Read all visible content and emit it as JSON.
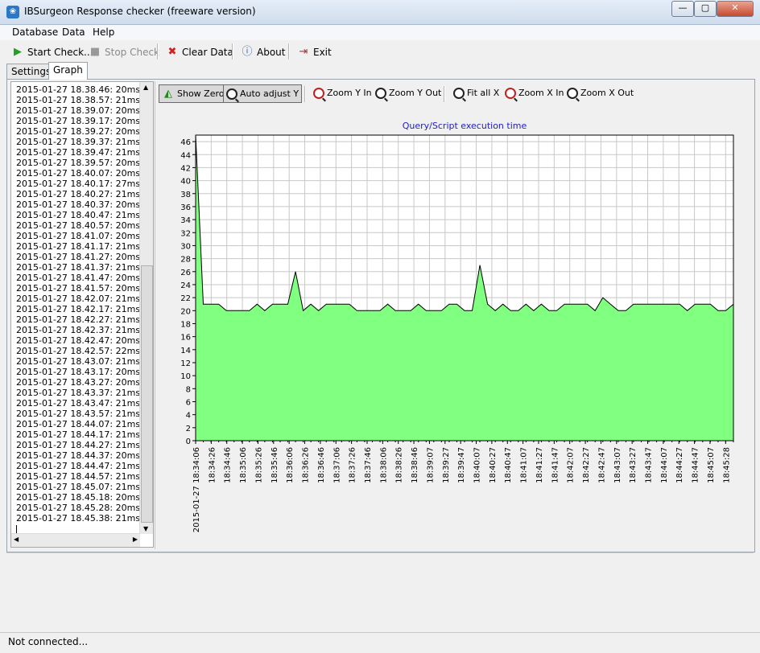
{
  "window": {
    "title": "IBSurgeon Response checker  (freeware version)",
    "buttons": {
      "minimize": "—",
      "maximize": "▢",
      "close": "✕"
    }
  },
  "menu": [
    "Database",
    "Data",
    "Help"
  ],
  "toolbar": {
    "start_check": "Start Check...",
    "stop_check": "Stop Check",
    "clear_data": "Clear Data",
    "about": "About",
    "exit": "Exit"
  },
  "tabs": [
    "Settings",
    "Graph"
  ],
  "log": [
    "2015-01-27 18.38.46: 20ms",
    "2015-01-27 18.38.57: 21ms",
    "2015-01-27 18.39.07: 20ms",
    "2015-01-27 18.39.17: 20ms",
    "2015-01-27 18.39.27: 20ms",
    "2015-01-27 18.39.37: 21ms",
    "2015-01-27 18.39.47: 21ms",
    "2015-01-27 18.39.57: 20ms",
    "2015-01-27 18.40.07: 20ms",
    "2015-01-27 18.40.17: 27ms",
    "2015-01-27 18.40.27: 21ms",
    "2015-01-27 18.40.37: 20ms",
    "2015-01-27 18.40.47: 21ms",
    "2015-01-27 18.40.57: 20ms",
    "2015-01-27 18.41.07: 20ms",
    "2015-01-27 18.41.17: 21ms",
    "2015-01-27 18.41.27: 20ms",
    "2015-01-27 18.41.37: 21ms",
    "2015-01-27 18.41.47: 20ms",
    "2015-01-27 18.41.57: 20ms",
    "2015-01-27 18.42.07: 21ms",
    "2015-01-27 18.42.17: 21ms",
    "2015-01-27 18.42.27: 21ms",
    "2015-01-27 18.42.37: 21ms",
    "2015-01-27 18.42.47: 20ms",
    "2015-01-27 18.42.57: 22ms",
    "2015-01-27 18.43.07: 21ms",
    "2015-01-27 18.43.17: 20ms",
    "2015-01-27 18.43.27: 20ms",
    "2015-01-27 18.43.37: 21ms",
    "2015-01-27 18.43.47: 21ms",
    "2015-01-27 18.43.57: 21ms",
    "2015-01-27 18.44.07: 21ms",
    "2015-01-27 18.44.17: 21ms",
    "2015-01-27 18.44.27: 21ms",
    "2015-01-27 18.44.37: 20ms",
    "2015-01-27 18.44.47: 21ms",
    "2015-01-27 18.44.57: 21ms",
    "2015-01-27 18.45.07: 21ms",
    "2015-01-27 18.45.18: 20ms",
    "2015-01-27 18.45.28: 20ms",
    "2015-01-27 18.45.38: 21ms"
  ],
  "graph_toolbar": {
    "show_zero": "Show Zero",
    "auto_adjust_y": "Auto adjust Y",
    "zoom_y_in": "Zoom Y In",
    "zoom_y_out": "Zoom Y Out",
    "fit_all_x": "Fit all X",
    "zoom_x_in": "Zoom X In",
    "zoom_x_out": "Zoom X Out"
  },
  "colors": {
    "fill": "#80ff80",
    "title": "#2020c0"
  },
  "chart_data": {
    "type": "area",
    "title": "Query/Script execution time",
    "ylim": [
      0,
      47
    ],
    "yticks": [
      0,
      2,
      4,
      6,
      8,
      10,
      12,
      14,
      16,
      18,
      20,
      22,
      24,
      26,
      28,
      30,
      32,
      34,
      36,
      38,
      40,
      42,
      44,
      46
    ],
    "grid": true,
    "x_tick_labels": [
      "2015-01-27 18:34:06",
      "18:34:26",
      "18:34:46",
      "18:35:06",
      "18:35:26",
      "18:35:46",
      "18:36:06",
      "18:36:26",
      "18:36:46",
      "18:37:06",
      "18:37:26",
      "18:37:46",
      "18:38:06",
      "18:38:26",
      "18:38:46",
      "18:39:07",
      "18:39:27",
      "18:39:47",
      "18:40:07",
      "18:40:27",
      "18:40:47",
      "18:41:07",
      "18:41:27",
      "18:41:47",
      "18:42:07",
      "18:42:27",
      "18:42:47",
      "18:43:07",
      "18:43:27",
      "18:43:47",
      "18:44:07",
      "18:44:27",
      "18:44:47",
      "18:45:07",
      "18:45:28"
    ],
    "values": [
      47,
      21,
      21,
      21,
      20,
      20,
      20,
      20,
      21,
      20,
      21,
      21,
      21,
      26,
      20,
      21,
      20,
      21,
      21,
      21,
      21,
      20,
      20,
      20,
      20,
      21,
      20,
      20,
      20,
      21,
      20,
      20,
      20,
      21,
      21,
      20,
      20,
      27,
      21,
      20,
      21,
      20,
      20,
      21,
      20,
      21,
      20,
      20,
      21,
      21,
      21,
      21,
      20,
      22,
      21,
      20,
      20,
      21,
      21,
      21,
      21,
      21,
      21,
      21,
      20,
      21,
      21,
      21,
      20,
      20,
      21
    ]
  },
  "status": "Not connected..."
}
